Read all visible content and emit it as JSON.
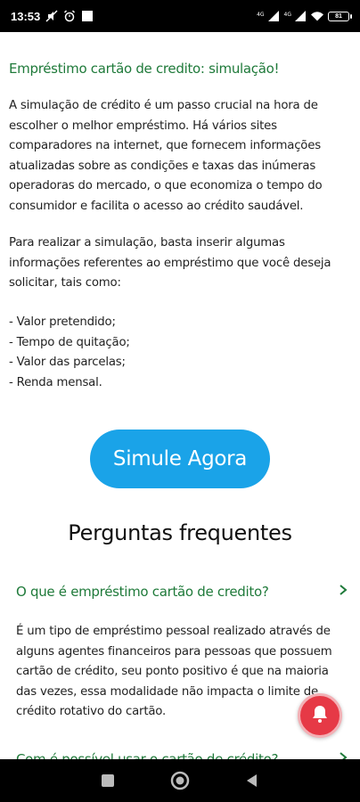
{
  "status_bar": {
    "time": "13:53",
    "signal_label_1": "4G",
    "signal_label_2": "4G",
    "battery_level": "81"
  },
  "article": {
    "section_title": "Empréstimo cartão de credito: simulação!",
    "paragraph_1": "A simulação de crédito é um passo crucial na hora de escolher o melhor empréstimo. Há vários sites comparadores na internet, que fornecem informações atualizadas sobre as condições e taxas das inúmeras operadoras do mercado, o que economiza o tempo do consumidor e facilita o acesso ao crédito saudável.",
    "paragraph_2": "Para realizar a simulação, basta inserir algumas informações referentes ao empréstimo que você deseja solicitar, tais como:",
    "bullets": [
      "- Valor pretendido;",
      "- Tempo de quitação;",
      "- Valor das parcelas;",
      "- Renda mensal."
    ]
  },
  "cta": {
    "label": "Simule Agora",
    "color": "#1aa3e8"
  },
  "faq": {
    "heading": "Perguntas frequentes",
    "items": [
      {
        "question": "O que é empréstimo cartão de credito?",
        "answer": "É um tipo de empréstimo pessoal realizado através de alguns agentes financeiros para pessoas que possuem cartão de crédito, seu ponto positivo é que na maioria das vezes, essa modalidade não impacta o limite de crédito rotativo do cartão."
      },
      {
        "question": "Com é possível usar o cartão de crédito?"
      }
    ]
  },
  "colors": {
    "accent_green": "#1f7a3a",
    "notification_red": "#e63946"
  },
  "icons": {
    "notification": "bell-icon",
    "nav_recents": "square-icon",
    "nav_home": "circle-icon",
    "nav_back": "triangle-back-icon"
  }
}
